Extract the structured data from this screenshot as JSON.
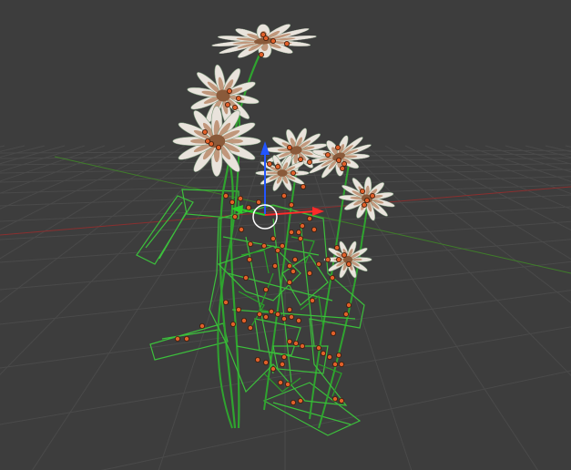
{
  "viewport": {
    "background": "#3d3d3d",
    "grid_color": "#4a4a4a",
    "x_axis_color": "#8a2f2f",
    "y_axis_color": "#3f7d2a"
  },
  "object": {
    "wire_color": "#3cbf3c",
    "wire_dark": "#1f7a1f",
    "vertex_color": "#e0602a",
    "petal_color": "#e9e3dc",
    "petal_shade": "#b88a6a",
    "center_color": "#8a5a3a"
  },
  "gizmo": {
    "z_color": "#2255ff",
    "x_color": "#ff2a2a",
    "y_color": "#2bd12b",
    "cursor_color": "#ffffff"
  }
}
